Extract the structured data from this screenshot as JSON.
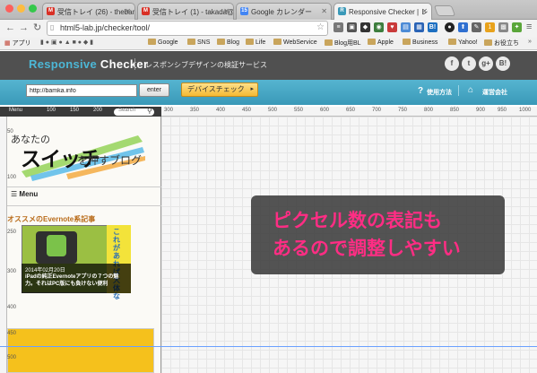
{
  "browser": {
    "tabs": [
      {
        "label": "受信トレイ (26) - thebamk",
        "favicon": "M"
      },
      {
        "label": "受信トレイ (1) - takada@s",
        "favicon": "M"
      },
      {
        "label": "Google カレンダー",
        "favicon": "15"
      },
      {
        "label": "Responsive Checker | レ",
        "favicon": "R"
      }
    ],
    "url": "html5-lab.jp/checker/tool/",
    "bookmarks": [
      "アプリ",
      "Google",
      "SNS",
      "Blog",
      "Life",
      "WebService",
      "Blog用BL",
      "Apple",
      "Business",
      "Yahoo!",
      "お役立ち"
    ],
    "extension_badge": "1"
  },
  "site": {
    "logo_a": "Responsive ",
    "logo_b": "Checker",
    "tagline": "レスポンシブデザインの検証サービス",
    "social": [
      "f",
      "t",
      "g+",
      "B!"
    ],
    "url_value": "http://bamka.info",
    "enter": "enter",
    "device_check": "デバイスチェック",
    "howto": "使用方法",
    "company": "運営会社"
  },
  "ruler": {
    "top": [
      "Menu",
      "100",
      "150",
      "200",
      "250",
      "Search",
      "300",
      "350",
      "400",
      "450",
      "500",
      "550",
      "600",
      "650",
      "700",
      "750",
      "800",
      "850",
      "900",
      "950",
      "1000",
      "1050"
    ],
    "left": [
      "50",
      "100",
      "150",
      "200",
      "250",
      "300",
      "350",
      "400",
      "450",
      "500"
    ]
  },
  "preview": {
    "blog_small1": "あなたの",
    "blog_big": "スイッチ",
    "blog_small2": "を押すブログ",
    "menu_label": "Menu",
    "section": "オススメのEvernote系記事",
    "card_date": "2014年02月20日",
    "card_title": "iPadの純正Evernoteアプリの７つの魅力。それはPC版にも負けない便利",
    "card_side": "これがあれば大体な"
  },
  "callout": {
    "line1": "ピクセル数の表記も",
    "line2": "あるので調整しやすい"
  },
  "colors": {
    "accent_pink": "#ff2d84",
    "header_bg": "#505050",
    "bar_blue": "#3a99b8",
    "logo_blue": "#4cb7d6"
  }
}
